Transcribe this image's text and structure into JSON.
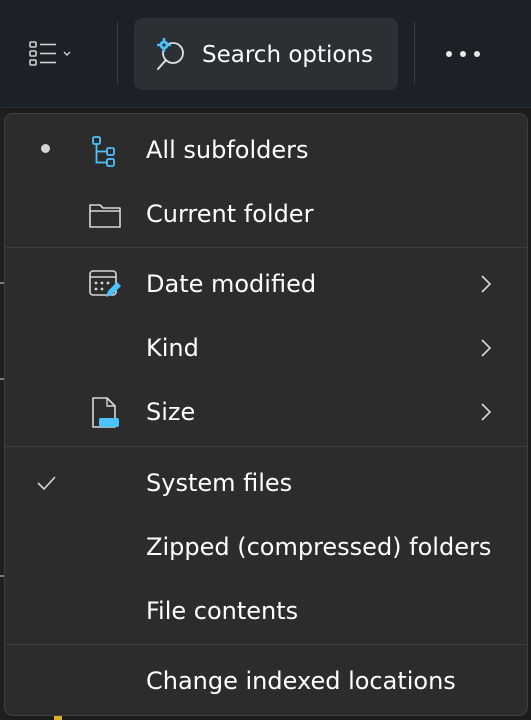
{
  "toolbar": {
    "view_icon": "list-view-icon",
    "search_options_label": "Search options",
    "search_options_icon": "search-settings-icon",
    "more_icon": "more-ellipsis-icon"
  },
  "menu": {
    "items": [
      {
        "label": "All subfolders",
        "icon": "folder-tree-icon",
        "state": "selected-bullet"
      },
      {
        "label": "Current folder",
        "icon": "folder-icon"
      },
      {
        "label": "Date modified",
        "icon": "calendar-edit-icon",
        "submenu": true
      },
      {
        "label": "Kind",
        "submenu": true
      },
      {
        "label": "Size",
        "icon": "file-size-icon",
        "submenu": true
      },
      {
        "label": "System files",
        "state": "checked"
      },
      {
        "label": "Zipped (compressed) folders"
      },
      {
        "label": "File contents"
      },
      {
        "label": "Change indexed locations"
      }
    ]
  },
  "colors": {
    "accent": "#4cc2ff",
    "menu_background": "#2c2c2c",
    "toolbar_background": "#1b2126"
  }
}
